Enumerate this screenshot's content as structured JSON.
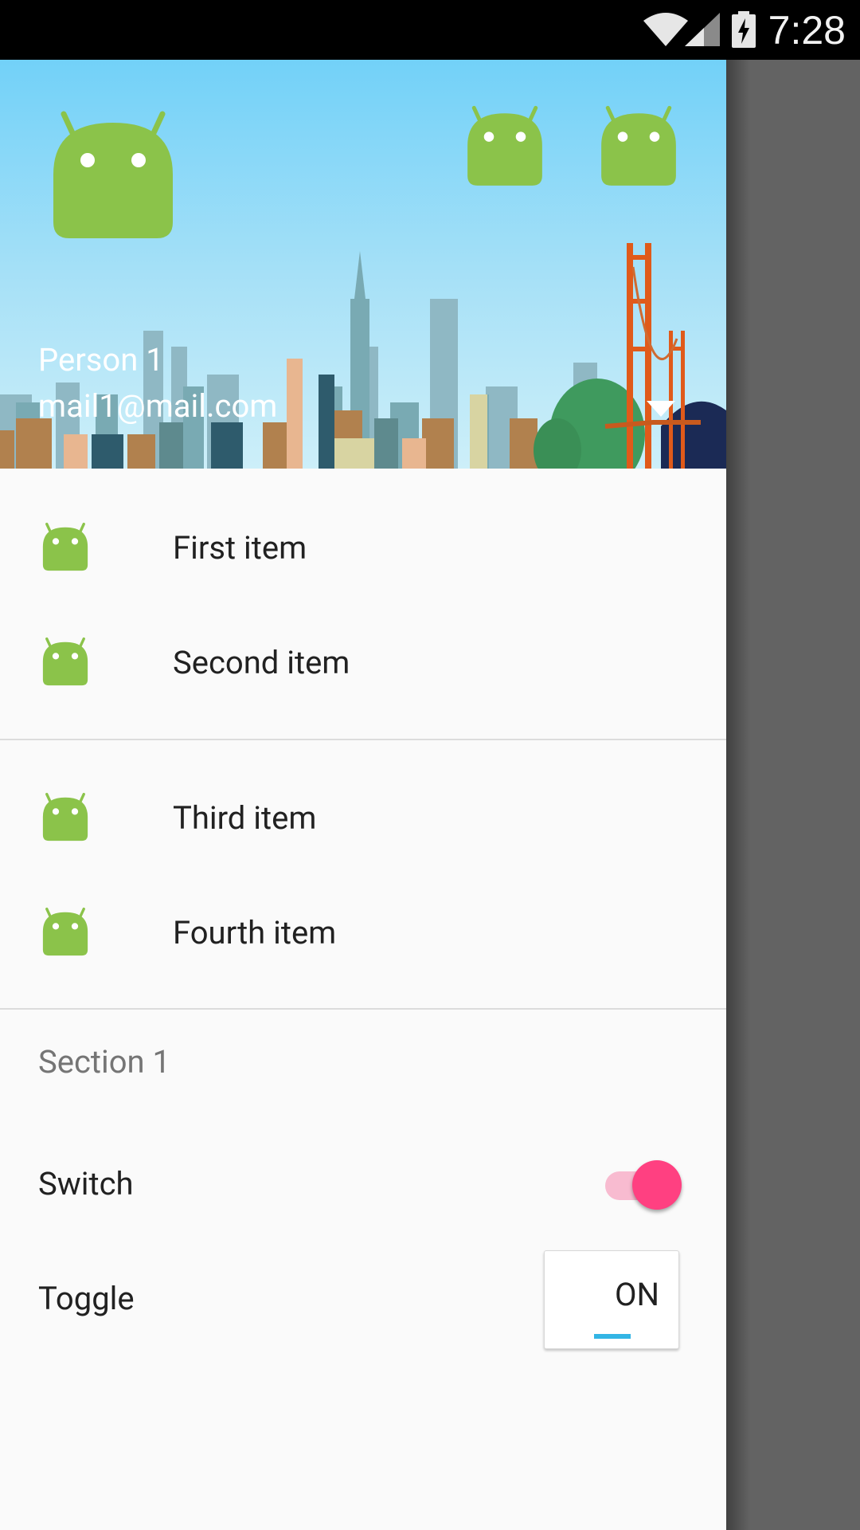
{
  "status_bar": {
    "time": "7:28",
    "icons": [
      "wifi-icon",
      "cell-signal-icon",
      "battery-charging-icon"
    ]
  },
  "header": {
    "account_name": "Person 1",
    "account_email": "mail1@mail.com",
    "dropdown_icon": "arrow-drop-down-icon",
    "avatars": [
      "android-avatar-icon",
      "android-avatar-icon",
      "android-avatar-icon"
    ]
  },
  "menu": {
    "group1": [
      {
        "label": "First item",
        "icon": "android-icon"
      },
      {
        "label": "Second item",
        "icon": "android-icon"
      }
    ],
    "group2": [
      {
        "label": "Third item",
        "icon": "android-icon"
      },
      {
        "label": "Fourth item",
        "icon": "android-icon"
      }
    ]
  },
  "section": {
    "title": "Section 1",
    "switch_label": "Switch",
    "switch_on": true,
    "toggle_label": "Toggle",
    "toggle_state": "ON"
  },
  "colors": {
    "accent": "#ff4081",
    "accent_light": "#f8bbd0",
    "toggle_indicator": "#33b5e5",
    "android_green": "#8bc34a"
  }
}
